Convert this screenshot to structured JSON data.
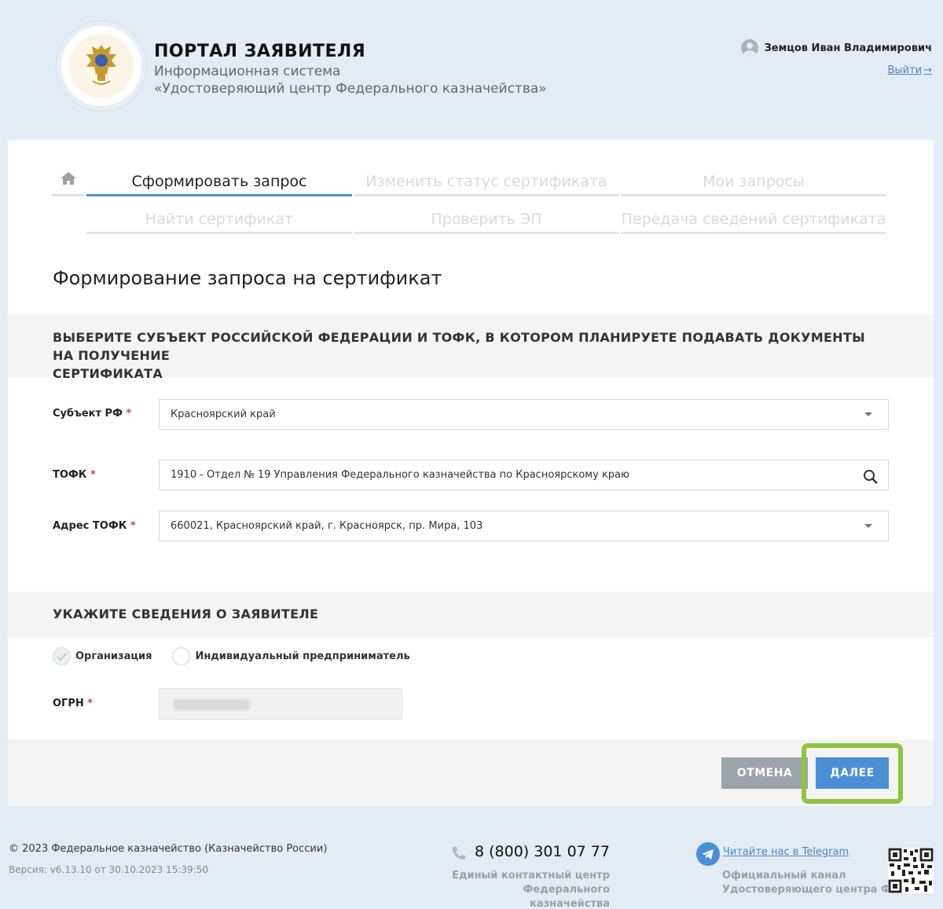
{
  "header": {
    "title": "ПОРТАЛ ЗАЯВИТЕЛЯ",
    "subtitle_line1": "Информационная система",
    "subtitle_line2": "«Удостоверяющий центр Федерального казначейства»",
    "user_name": "Земцов Иван Владимирович",
    "logout_label": "Выйти",
    "logout_arrow": "→"
  },
  "nav": {
    "home_icon": "home-icon",
    "tabs": [
      {
        "label": "Сформировать запрос",
        "active": true
      },
      {
        "label": "Изменить статус сертификата",
        "active": false
      },
      {
        "label": "Мои запросы",
        "active": false
      },
      {
        "label": "Найти сертификат",
        "active": false
      },
      {
        "label": "Проверить ЭП",
        "active": false
      },
      {
        "label": "Передача сведений сертификата",
        "active": false
      }
    ]
  },
  "page_title": "Формирование запроса на сертификат",
  "section1": {
    "heading_line1": "ВЫБЕРИТЕ СУБЪЕКТ РОССИЙСКОЙ ФЕДЕРАЦИИ И ТОФК, В КОТОРОМ ПЛАНИРУЕТЕ ПОДАВАТЬ ДОКУМЕНТЫ НА ПОЛУЧЕНИЕ",
    "heading_line2": "СЕРТИФИКАТА",
    "region_label": "Субъект РФ",
    "region_value": "Красноярский край",
    "tofk_label": "ТОФК",
    "tofk_value": "1910 - Отдел № 19 Управления Федерального казначейства по Красноярскому краю",
    "address_label": "Адрес ТОФК",
    "address_value": "660021, Красноярский край, г. Красноярск, пр. Мира, 103",
    "required_mark": "*"
  },
  "section2": {
    "heading": "УКАЖИТЕ СВЕДЕНИЯ О ЗАЯВИТЕЛЕ",
    "radio_org": "Организация",
    "radio_ip": "Индивидуальный предприниматель",
    "selected": "Организация",
    "ogrn_label": "ОГРН"
  },
  "actions": {
    "cancel": "ОТМЕНА",
    "next": "ДАЛЕЕ"
  },
  "footer": {
    "copyright": "© 2023 Федеральное казначейство (Казначейство России)",
    "version": "Версия: v6.13.10 от 30.10.2023 15:39:50",
    "phone": "8 (800) 301 07 77",
    "contact_line1": "Единый контактный центр",
    "contact_line2": "Федерального казначейства",
    "telegram_link": "Читайте нас в Telegram",
    "telegram_line1": "Официальный канал",
    "telegram_line2": "Удостоверяющего центра ФК"
  },
  "colors": {
    "accent": "#4a8fd6",
    "highlight": "#8ec53f",
    "background": "#e3ecf4",
    "required": "#e23b3b"
  }
}
